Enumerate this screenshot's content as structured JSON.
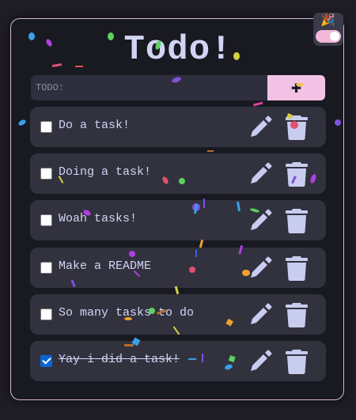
{
  "app": {
    "title": "Todo!",
    "theme_toggle": {
      "emoji": "🎉",
      "on": true
    }
  },
  "composer": {
    "placeholder": "TODO:",
    "value": "",
    "add_label": "✚"
  },
  "tasks": [
    {
      "label": "Do a task!",
      "done": false
    },
    {
      "label": "Doing a task!",
      "done": false
    },
    {
      "label": "Woah tasks!",
      "done": false
    },
    {
      "label": "Make a README",
      "done": false
    },
    {
      "label": "So many tasks to do",
      "done": false
    },
    {
      "label": "Yay i did a task!",
      "done": true
    }
  ],
  "colors": {
    "background": "#1e1d26",
    "card": "#191922",
    "card_border": "#d9b7d9",
    "task_bg": "#32323f",
    "text": "#d2d4f3",
    "accent_pink": "#f3c3e6",
    "icon": "#c8cdf0",
    "checkbox_checked": "#0a64d2"
  }
}
